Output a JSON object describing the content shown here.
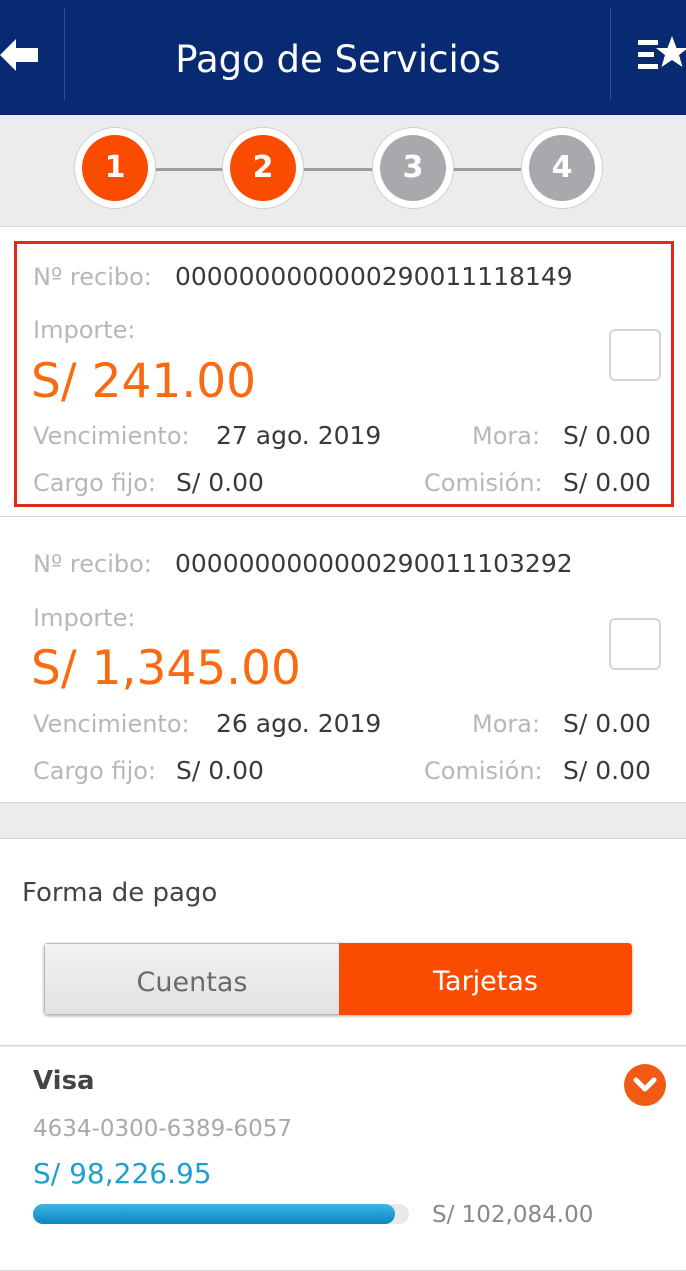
{
  "header": {
    "title": "Pago de Servicios",
    "back_icon": "arrow-left-icon",
    "menu_icon": "list-star-icon",
    "bg_color": "#072a73"
  },
  "stepper": {
    "steps": [
      {
        "label": "1",
        "state": "active"
      },
      {
        "label": "2",
        "state": "active"
      },
      {
        "label": "3",
        "state": "inactive"
      },
      {
        "label": "4",
        "state": "inactive"
      }
    ],
    "active_color": "#fa4c00",
    "inactive_color": "#a9a9ad"
  },
  "receipts": [
    {
      "receipt_label": "Nº recibo:",
      "receipt_number": "0000000000000290011118149",
      "amount_label": "Importe:",
      "amount": "S/ 241.00",
      "due_label": "Vencimiento:",
      "due_date": "27 ago. 2019",
      "late_label": "Mora:",
      "late_fee": "S/ 0.00",
      "fixed_label": "Cargo fijo:",
      "fixed_fee": "S/ 0.00",
      "commission_label": "Comisión:",
      "commission": "S/ 0.00",
      "highlighted": true
    },
    {
      "receipt_label": "Nº recibo:",
      "receipt_number": "0000000000000290011103292",
      "amount_label": "Importe:",
      "amount": "S/ 1,345.00",
      "due_label": "Vencimiento:",
      "due_date": "26 ago. 2019",
      "late_label": "Mora:",
      "late_fee": "S/ 0.00",
      "fixed_label": "Cargo fijo:",
      "fixed_fee": "S/ 0.00",
      "commission_label": "Comisión:",
      "commission": "S/ 0.00",
      "highlighted": false
    }
  ],
  "payment": {
    "title": "Forma de pago",
    "options": [
      {
        "label": "Cuentas",
        "selected": false
      },
      {
        "label": "Tarjetas",
        "selected": true
      }
    ]
  },
  "card": {
    "name": "Visa",
    "number": "4634-0300-6389-6057",
    "available": "S/ 98,226.95",
    "limit": "S/ 102,084.00",
    "used_fraction": 0.962,
    "toggle_icon": "chevron-down-circle-icon"
  }
}
